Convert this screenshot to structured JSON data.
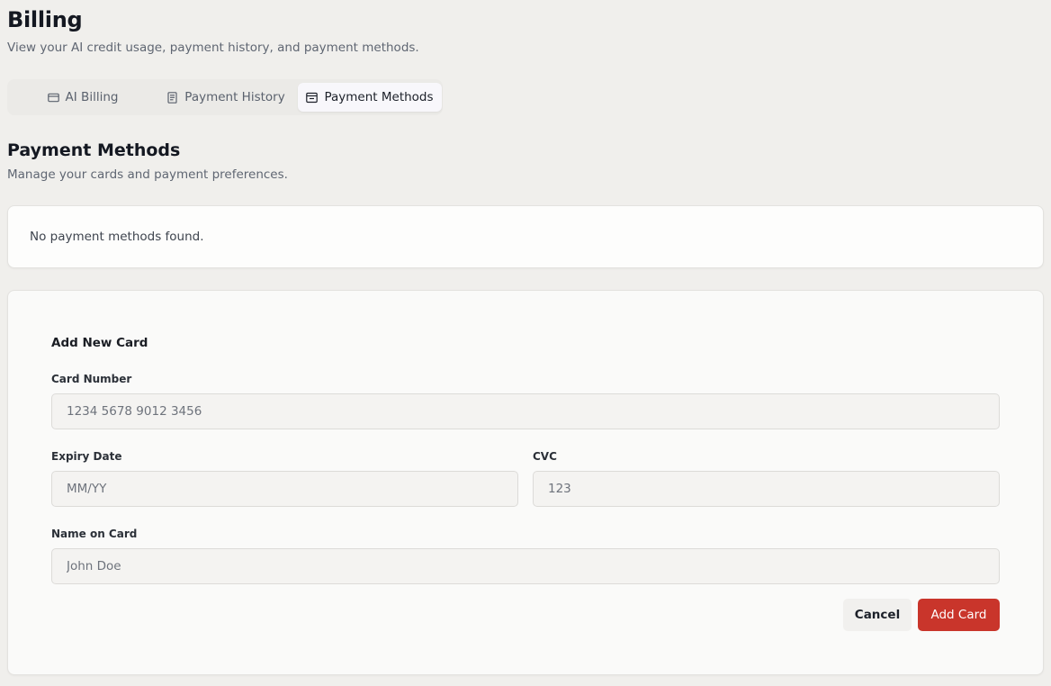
{
  "header": {
    "title": "Billing",
    "subtitle": "View your AI credit usage, payment history, and payment methods."
  },
  "tabs": [
    {
      "label": "AI Billing",
      "icon": "credit-card-icon",
      "active": false
    },
    {
      "label": "Payment History",
      "icon": "receipt-icon",
      "active": false
    },
    {
      "label": "Payment Methods",
      "icon": "wallet-icon",
      "active": true
    }
  ],
  "section": {
    "title": "Payment Methods",
    "subtitle": "Manage your cards and payment preferences."
  },
  "empty_state": {
    "text": "No payment methods found."
  },
  "form": {
    "title": "Add New Card",
    "card_number": {
      "label": "Card Number",
      "placeholder": "1234 5678 9012 3456",
      "value": ""
    },
    "expiry": {
      "label": "Expiry Date",
      "placeholder": "MM/YY",
      "value": ""
    },
    "cvc": {
      "label": "CVC",
      "placeholder": "123",
      "value": ""
    },
    "name": {
      "label": "Name on Card",
      "placeholder": "John Doe",
      "value": ""
    },
    "cancel_label": "Cancel",
    "submit_label": "Add Card"
  },
  "colors": {
    "background": "#f0efec",
    "accent": "#c9352b",
    "card": "#fdfdfc",
    "input": "#f4f3f1"
  }
}
